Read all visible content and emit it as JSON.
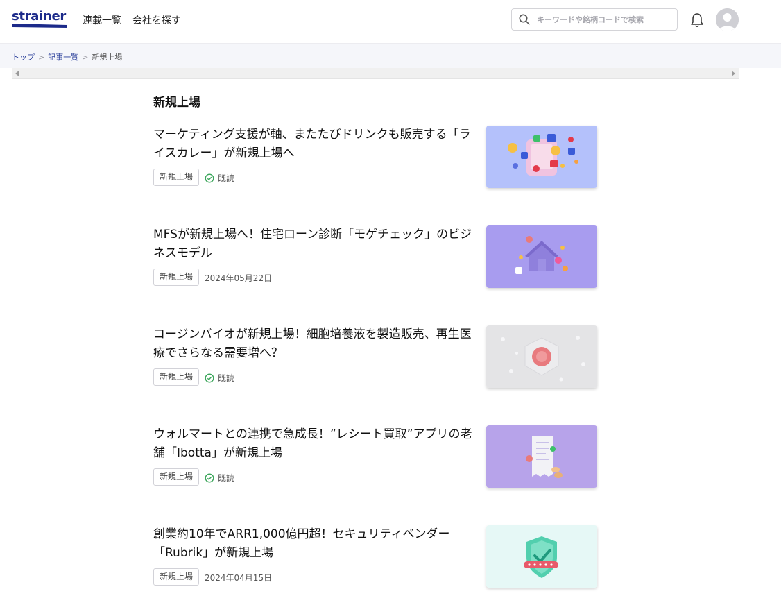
{
  "header": {
    "logo_text": "strainer",
    "nav": [
      "連載一覧",
      "会社を探す"
    ],
    "search_placeholder": "キーワードや銘柄コードで検索"
  },
  "breadcrumb": {
    "items": [
      "トップ",
      "記事一覧"
    ],
    "current": "新規上場"
  },
  "section_title": "新規上場",
  "articles": [
    {
      "title": "マーケティング支援が軸、またたびドリンクも販売する「ライスカレー」が新規上場へ",
      "tag": "新規上場",
      "status": "既読",
      "thumb": "social-media-phone-illustration"
    },
    {
      "title": "MFSが新規上場へ！住宅ローン診断「モゲチェック」のビジネスモデル",
      "tag": "新規上場",
      "date": "2024年05月22日",
      "thumb": "house-loan-illustration"
    },
    {
      "title": "コージンバイオが新規上場！細胞培養液を製造販売、再生医療でさらなる需要増へ？",
      "tag": "新規上場",
      "status": "既読",
      "thumb": "cell-culture-illustration"
    },
    {
      "title": "ウォルマートとの連携で急成長！”レシート買取”アプリの老舗「Ibotta」が新規上場",
      "tag": "新規上場",
      "status": "既読",
      "thumb": "receipt-app-illustration"
    },
    {
      "title": "創業約10年でARR1,000億円超！セキュリティベンダー「Rubrik」が新規上場",
      "tag": "新規上場",
      "date": "2024年04月15日",
      "thumb": "security-shield-illustration"
    }
  ],
  "colors": {
    "brand": "#1c2a8a",
    "link": "#2a3f9a",
    "read_check": "#3aa55a"
  }
}
